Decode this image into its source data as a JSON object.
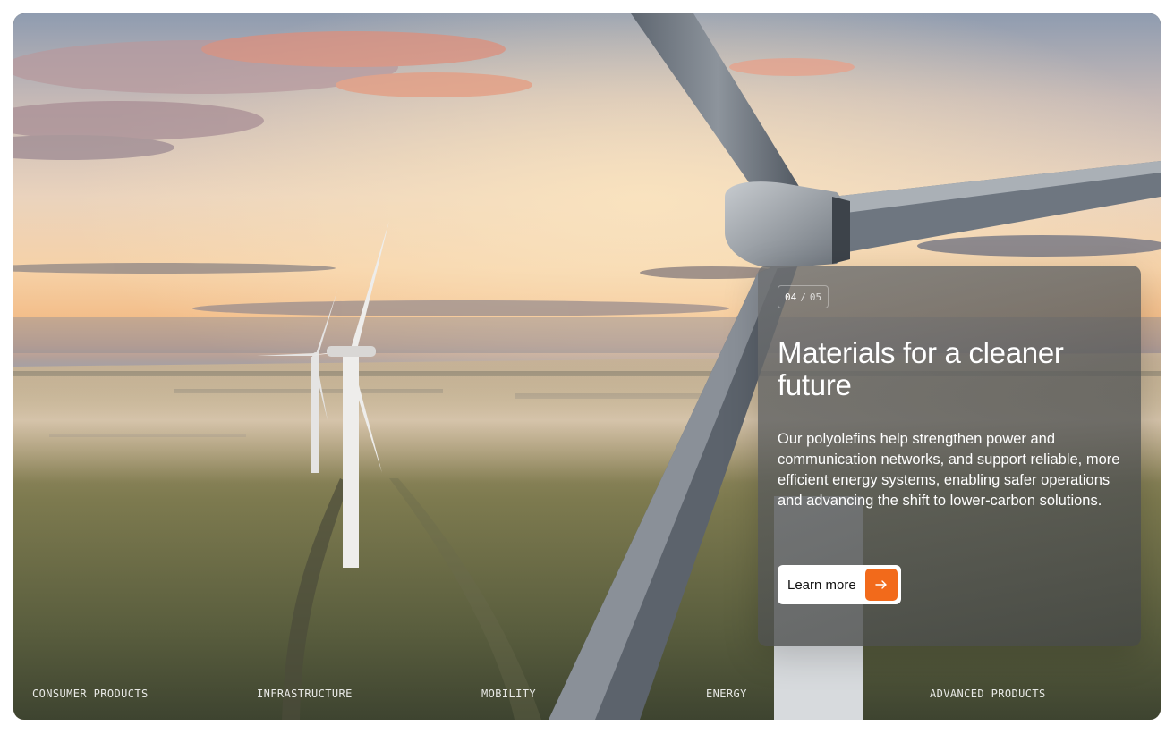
{
  "slide": {
    "current": "04",
    "separator": "/",
    "total": "05",
    "title": "Materials for a cleaner future",
    "body": "Our polyolefins help strengthen power and communication networks, and support reliable, more efficient energy systems, enabling safer operations and advancing the shift to lower-carbon solutions.",
    "cta_label": "Learn more",
    "cta_icon": "arrow-right-icon"
  },
  "categories": [
    {
      "label": "CONSUMER PRODUCTS"
    },
    {
      "label": "INFRASTRUCTURE"
    },
    {
      "label": "MOBILITY"
    },
    {
      "label": "ENERGY"
    },
    {
      "label": "ADVANCED PRODUCTS"
    }
  ],
  "colors": {
    "accent": "#f26a1b",
    "button_bg": "#ffffff",
    "text": "#ffffff"
  }
}
